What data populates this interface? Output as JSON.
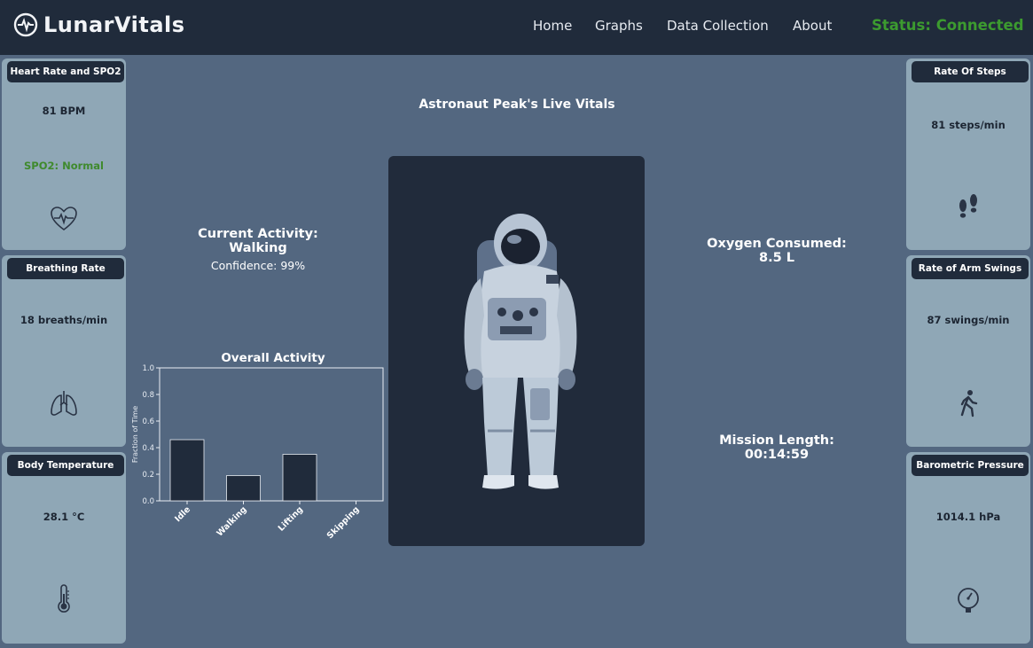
{
  "app": {
    "name": "LunarVitals"
  },
  "nav": [
    {
      "label": "Home"
    },
    {
      "label": "Graphs"
    },
    {
      "label": "Data Collection"
    },
    {
      "label": "About"
    }
  ],
  "status": {
    "text": "Status: Connected",
    "color": "#3c9b2f"
  },
  "cards_left": [
    {
      "title": "Heart Rate and SPO2",
      "value": "81 BPM",
      "secondary": "SPO2: Normal",
      "icon": "heart-pulse-icon"
    },
    {
      "title": "Breathing Rate",
      "value": "18 breaths/min",
      "icon": "lungs-icon"
    },
    {
      "title": "Body Temperature",
      "value": "28.1 °C",
      "icon": "thermometer-icon"
    }
  ],
  "cards_right": [
    {
      "title": "Rate Of Steps",
      "value": "81 steps/min",
      "icon": "footprints-icon"
    },
    {
      "title": "Rate of Arm Swings",
      "value": "87 swings/min",
      "icon": "walking-person-icon"
    },
    {
      "title": "Barometric Pressure",
      "value": "1014.1 hPa",
      "icon": "pressure-gauge-icon"
    }
  ],
  "main": {
    "title": "Astronaut Peak's Live Vitals",
    "activity_label": "Current Activity:",
    "activity_value": "Walking",
    "confidence": "Confidence: 99%",
    "oxygen_label": "Oxygen Consumed:",
    "oxygen_value": "8.5 L",
    "mission_label": "Mission Length:",
    "mission_value": "00:14:59"
  },
  "chart_data": {
    "type": "bar",
    "title": "Overall Activity",
    "ylabel": "Fraction of Time",
    "xlabel": "",
    "categories": [
      "Idle",
      "Walking",
      "Lifting",
      "Skipping"
    ],
    "values": [
      0.46,
      0.19,
      0.35,
      0.0
    ],
    "ylim": [
      0,
      1.0
    ],
    "yticks": [
      "0.0",
      "0.2",
      "0.4",
      "0.6",
      "0.8",
      "1.0"
    ],
    "bar_color": "#202b3b",
    "grid": false
  },
  "colors": {
    "background": "#536780",
    "topbar": "#202b3b",
    "card": "#8fa7b6",
    "accent_green": "#3c9b2f"
  }
}
